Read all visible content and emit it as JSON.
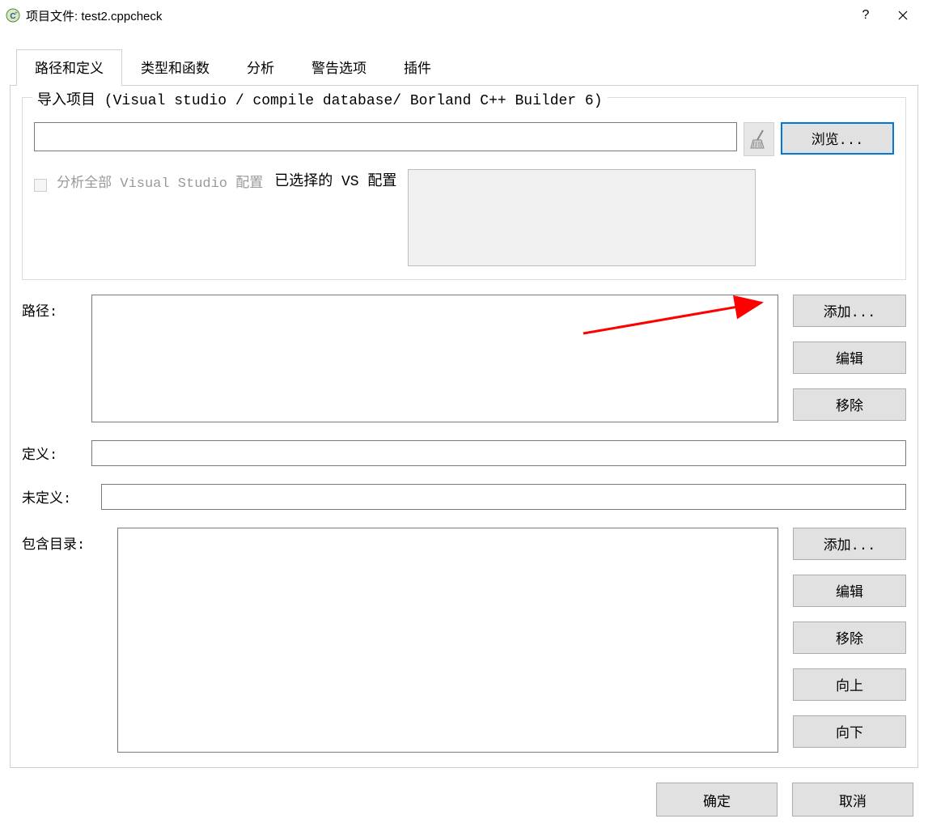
{
  "titlebar": {
    "title": "项目文件: test2.cppcheck"
  },
  "tabs": [
    {
      "label": "路径和定义",
      "active": true
    },
    {
      "label": "类型和函数",
      "active": false
    },
    {
      "label": "分析",
      "active": false
    },
    {
      "label": "警告选项",
      "active": false
    },
    {
      "label": "插件",
      "active": false
    }
  ],
  "import_group": {
    "title": "导入项目 (Visual studio / compile database/ Borland C++ Builder 6)",
    "path_value": "",
    "browse_label": "浏览...",
    "analyze_all_label": "分析全部 Visual Studio 配置",
    "selected_vs_label": "已选择的 VS 配置"
  },
  "paths": {
    "label": "路径:",
    "add_label": "添加...",
    "edit_label": "编辑",
    "remove_label": "移除"
  },
  "defines": {
    "label": "定义:",
    "value": ""
  },
  "undefines": {
    "label": "未定义:",
    "value": ""
  },
  "includes": {
    "label": "包含目录:",
    "add_label": "添加...",
    "edit_label": "编辑",
    "remove_label": "移除",
    "up_label": "向上",
    "down_label": "向下"
  },
  "footer": {
    "ok_label": "确定",
    "cancel_label": "取消"
  }
}
